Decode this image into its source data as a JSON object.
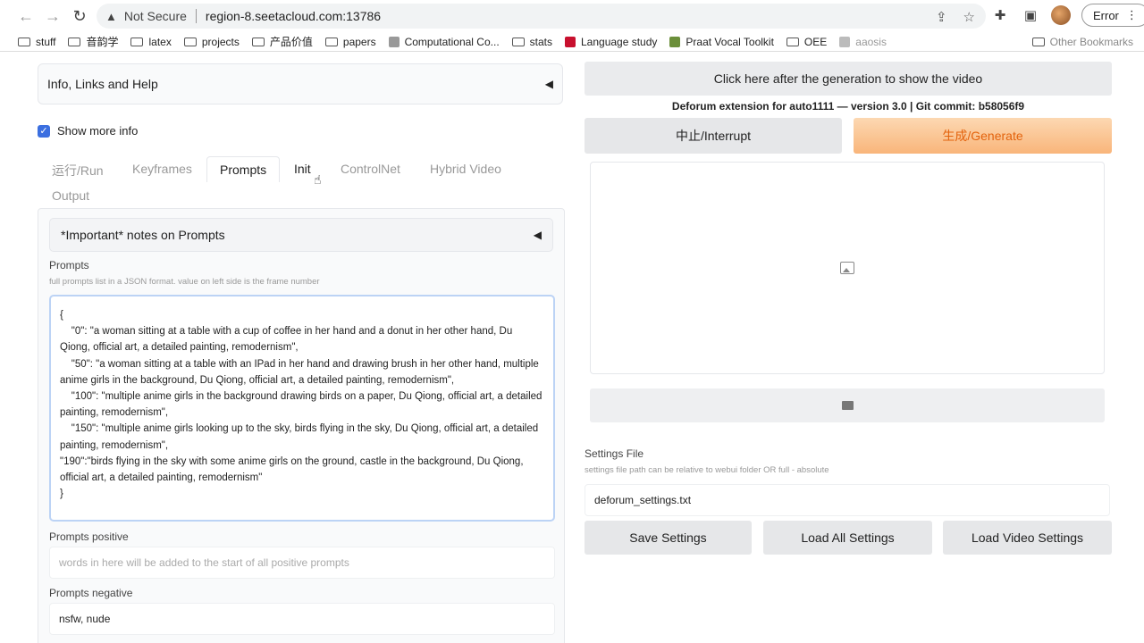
{
  "browser": {
    "not_secure": "Not Secure",
    "url": "region-8.seetacloud.com:13786",
    "error_label": "Error",
    "bookmarks": [
      {
        "label": "stuff",
        "icon": "folder-icon"
      },
      {
        "label": "音韵学",
        "icon": "folder-icon"
      },
      {
        "label": "latex",
        "icon": "folder-icon"
      },
      {
        "label": "projects",
        "icon": "folder-icon"
      },
      {
        "label": "产品价值",
        "icon": "folder-icon"
      },
      {
        "label": "papers",
        "icon": "folder-icon"
      },
      {
        "label": "Computational Co...",
        "icon": "site-icon"
      },
      {
        "label": "stats",
        "icon": "folder-icon"
      },
      {
        "label": "Language study",
        "icon": "site-icon"
      },
      {
        "label": "Praat Vocal Toolkit",
        "icon": "site-icon"
      },
      {
        "label": "OEE",
        "icon": "folder-icon"
      },
      {
        "label": "aaosis",
        "icon": "site-icon"
      }
    ],
    "other_bookmarks": "Other Bookmarks"
  },
  "left": {
    "info_accordion": "Info, Links and Help",
    "show_more_info": "Show more info",
    "tabs": [
      "运行/Run",
      "Keyframes",
      "Prompts",
      "Init",
      "ControlNet",
      "Hybrid Video",
      "Output"
    ],
    "active_tab": "Prompts",
    "notes_accordion": "*Important* notes on Prompts",
    "prompts_label": "Prompts",
    "prompts_hint": "full prompts list in a JSON format. value on left side is the frame number",
    "prompts_value": "{\n    \"0\": \"a woman sitting at a table with a cup of coffee in her hand and a donut in her other hand, Du Qiong, official art, a detailed painting, remodernism\",\n    \"50\": \"a woman sitting at a table with an IPad in her hand and drawing brush in her other hand, multiple anime girls in the background, Du Qiong, official art, a detailed painting, remodernism\",\n    \"100\": \"multiple anime girls in the background drawing birds on a paper, Du Qiong, official art, a detailed painting, remodernism\",\n    \"150\": \"multiple anime girls looking up to the sky, birds flying in the sky, Du Qiong, official art, a detailed painting, remodernism\",\n\"190\":\"birds flying in the sky with some anime girls on the ground, castle in the background, Du Qiong, official art, a detailed painting, remodernism\"\n}",
    "positive_label": "Prompts positive",
    "positive_placeholder": "words in here will be added to the start of all positive prompts",
    "negative_label": "Prompts negative",
    "negative_value": "nsfw, nude"
  },
  "right": {
    "show_video": "Click here after the generation to show the video",
    "ext_info": "Deforum extension for auto1111 — version 3.0 | Git commit: b58056f9",
    "interrupt": "中止/Interrupt",
    "generate": "生成/Generate",
    "settings_label": "Settings File",
    "settings_hint": "settings file path can be relative to webui folder OR full - absolute",
    "settings_value": "deforum_settings.txt",
    "save_settings": "Save Settings",
    "load_all": "Load All Settings",
    "load_video": "Load Video Settings"
  },
  "colors": {
    "accent": "#3b6fe0",
    "generate_text": "#e3620c",
    "generate_bg": "#f9b57a"
  }
}
